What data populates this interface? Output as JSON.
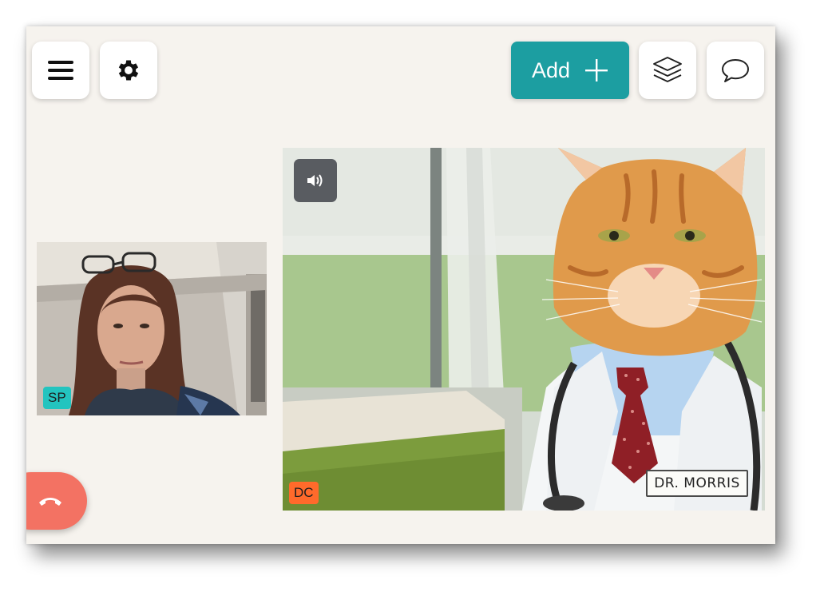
{
  "toolbar": {
    "add_label": "Add",
    "icons": {
      "menu": "menu-icon",
      "settings": "gear-icon",
      "add": "plus-icon",
      "layers": "layers-icon",
      "chat": "chat-bubble-icon"
    }
  },
  "participants": {
    "self": {
      "initials": "SP",
      "badge_color": "#23c4bf"
    },
    "main": {
      "initials": "DC",
      "badge_color": "#ff6a2b",
      "name_tag": "DR. MORRIS"
    }
  },
  "controls": {
    "sound_icon": "speaker-icon",
    "hangup_icon": "phone-hangup-icon"
  },
  "colors": {
    "accent": "#1c9ea1",
    "hangup": "#f37263",
    "background": "#f6f3ee"
  }
}
